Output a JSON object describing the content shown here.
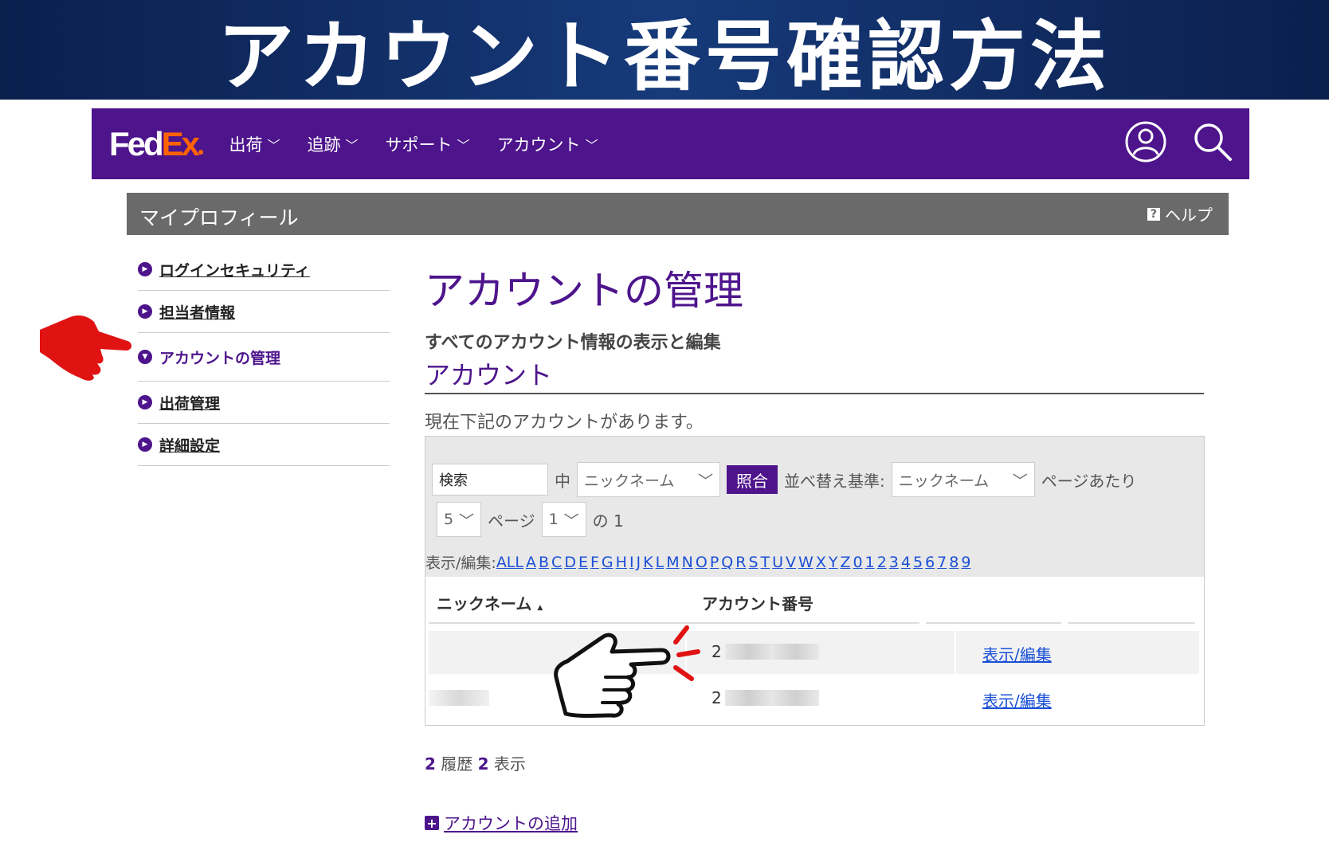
{
  "banner": {
    "title": "アカウント番号確認方法"
  },
  "nav": {
    "logo_fed": "Fed",
    "logo_ex": "Ex",
    "items": [
      {
        "label": "出荷"
      },
      {
        "label": "追跡"
      },
      {
        "label": "サポート"
      },
      {
        "label": "アカウント"
      }
    ],
    "chevron": "﹀"
  },
  "profile": {
    "title": "マイプロフィール",
    "help_badge": "?",
    "help_label": "ヘルプ"
  },
  "sidebar": {
    "items": [
      {
        "label": "ログインセキュリティ",
        "active": false
      },
      {
        "label": "担当者情報",
        "active": false
      },
      {
        "label": "アカウントの管理",
        "active": true
      },
      {
        "label": "出荷管理",
        "active": false
      },
      {
        "label": "詳細設定",
        "active": false
      }
    ]
  },
  "main": {
    "title": "アカウントの管理",
    "subhead": "すべてのアカウント情報の表示と編集",
    "section_label": "アカウント",
    "intro": "現在下記のアカウントがあります。"
  },
  "controls": {
    "search_value": "検索",
    "in_label": "中",
    "search_field_select": "ニックネーム",
    "match_button": "照合",
    "sort_label": "並べ替え基準:",
    "sort_select": "ニックネーム",
    "per_page_label": "ページあたり",
    "per_page_value": "5",
    "page_label": "ページ",
    "page_value": "1",
    "of_label": "の 1",
    "filter_label": "表示/編集:",
    "letters": [
      "ALL",
      "A",
      "B",
      "C",
      "D",
      "E",
      "F",
      "G",
      "H",
      "I",
      "J",
      "K",
      "L",
      "M",
      "N",
      "O",
      "P",
      "Q",
      "R",
      "S",
      "T",
      "U",
      "V",
      "W",
      "X",
      "Y",
      "Z",
      "0",
      "1",
      "2",
      "3",
      "4",
      "5",
      "6",
      "7",
      "8",
      "9"
    ]
  },
  "table": {
    "col_nickname": "ニックネーム",
    "sort_indicator": "▲",
    "col_account": "アカウント番号",
    "rows": [
      {
        "account_prefix": "2",
        "action": "表示/編集"
      },
      {
        "account_prefix": "2",
        "action": "表示/編集"
      }
    ]
  },
  "summary": {
    "count1": "2",
    "history_label": " 履歴 ",
    "count2": "2",
    "display_label": " 表示"
  },
  "add_account": {
    "icon": "+",
    "label": "アカウントの追加"
  },
  "colors": {
    "fedex_purple": "#4d148c",
    "fedex_orange": "#ff6200",
    "banner_navy": "#0b1f4d",
    "link_blue": "#1a4fd6",
    "pointer_red": "#e01212"
  }
}
